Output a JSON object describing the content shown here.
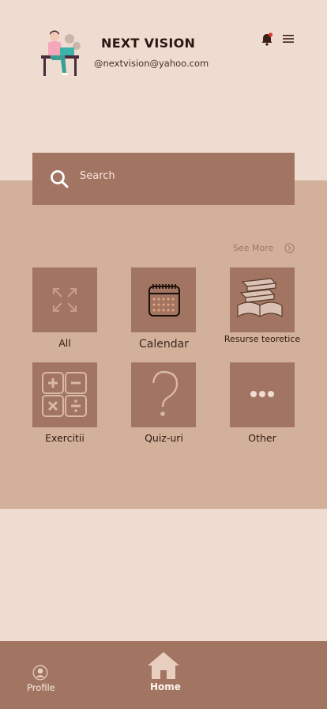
{
  "header": {
    "title": "NEXT VISION",
    "email": "@nextvision@yahoo.com"
  },
  "search": {
    "placeholder": "Search"
  },
  "categories": {
    "see_more_label": "See More",
    "items": [
      {
        "label": "All",
        "icon": "expand-arrows-icon"
      },
      {
        "label": "Calendar",
        "icon": "calendar-icon"
      },
      {
        "label": "Resurse teoretice",
        "icon": "books-icon"
      },
      {
        "label": "Exercitii",
        "icon": "math-operators-icon"
      },
      {
        "label": "Quiz-uri",
        "icon": "question-mark-icon"
      },
      {
        "label": "Other",
        "icon": "more-dots-icon"
      }
    ]
  },
  "bottom_nav": {
    "items": [
      {
        "label": "Profile",
        "icon": "profile-icon"
      },
      {
        "label": "Home",
        "icon": "home-icon",
        "active": true
      }
    ]
  },
  "colors": {
    "background": "#efdcd1",
    "band": "#d3b099",
    "accent": "#a27462",
    "text": "#2a1710"
  }
}
